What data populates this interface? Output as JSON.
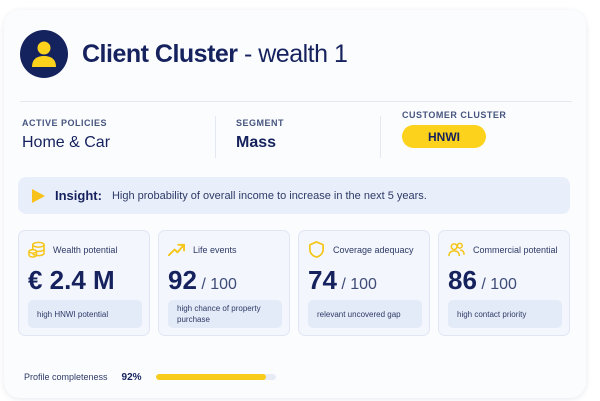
{
  "header": {
    "title_bold": "Client Cluster",
    "title_rest": " - wealth 1",
    "avatar_icon": "user-icon"
  },
  "info": {
    "active_policies": {
      "label": "ACTIVE POLICIES",
      "value": "Home & Car"
    },
    "segment": {
      "label": "SEGMENT",
      "value": "Mass"
    },
    "customer_cluster": {
      "label": "CUSTOMER CLUSTER",
      "value": "HNWI"
    }
  },
  "insight": {
    "icon": "play-icon",
    "label": "Insight:",
    "text": "High probability of overall income to increase in the next 5 years."
  },
  "kpis": [
    {
      "icon": "coins-icon",
      "title": "Wealth potential",
      "value": "€ 2.4 M",
      "suffix": "",
      "note": "high HNWI potential"
    },
    {
      "icon": "trend-up-icon",
      "title": "Life events",
      "value": "92",
      "suffix": " / 100",
      "note": "high chance of property purchase"
    },
    {
      "icon": "shield-icon",
      "title": "Coverage adequacy",
      "value": "74",
      "suffix": " / 100",
      "note": "relevant uncovered gap"
    },
    {
      "icon": "users-icon",
      "title": "Commercial potential",
      "value": "86",
      "suffix": " / 100",
      "note": "high contact priority"
    }
  ],
  "completeness": {
    "label": "Profile completeness",
    "percent_text": "92%",
    "fraction": 0.92
  },
  "colors": {
    "navy": "#15225e",
    "accent_yellow": "#fcd21c",
    "insight_bg": "#e9effa"
  }
}
